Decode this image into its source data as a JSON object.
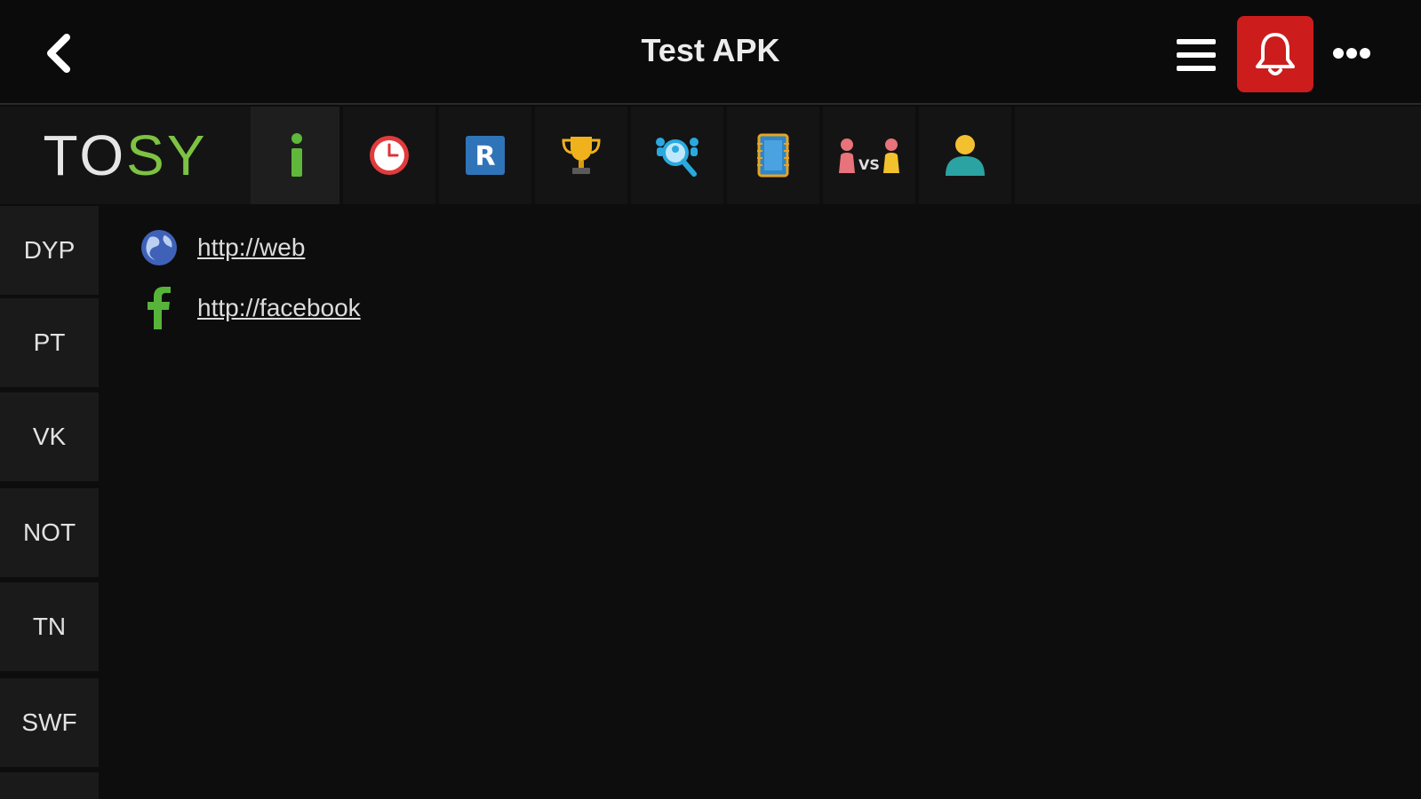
{
  "header": {
    "title": "Test APK",
    "back_icon": "chevron-left-icon",
    "menu_icon": "hamburger-menu-icon",
    "notification_icon": "bell-icon",
    "more_icon": "ellipsis-icon",
    "notification_bg": "#cc1c1c"
  },
  "toolbar": {
    "logo_part1": "TO",
    "logo_part2": "SY",
    "logo_accent": "#7dc242",
    "tabs": [
      {
        "icon": "info-icon",
        "active": true
      },
      {
        "icon": "clock-icon",
        "active": false
      },
      {
        "icon": "r-badge-icon",
        "active": false
      },
      {
        "icon": "trophy-icon",
        "active": false
      },
      {
        "icon": "search-people-icon",
        "active": false
      },
      {
        "icon": "notebook-icon",
        "active": false
      },
      {
        "icon": "versus-icon",
        "active": false
      },
      {
        "icon": "user-icon",
        "active": false
      }
    ]
  },
  "sidebar": {
    "items": [
      {
        "label": "DYP"
      },
      {
        "label": "PT"
      },
      {
        "label": "VK"
      },
      {
        "label": "NOT"
      },
      {
        "label": "TN"
      },
      {
        "label": "SWF"
      }
    ]
  },
  "main": {
    "links": [
      {
        "icon": "globe-icon",
        "text": "http://web"
      },
      {
        "icon": "facebook-icon",
        "text": "http://facebook"
      }
    ]
  }
}
